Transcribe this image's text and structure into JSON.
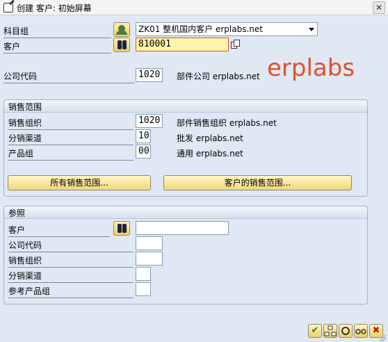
{
  "window": {
    "title": "创建 客户: 初始屏幕",
    "close_glyph": "✕"
  },
  "fields": {
    "account_group": {
      "label": "科目组",
      "value": "ZK01 整机国内客户 erplabs.net"
    },
    "customer": {
      "label": "客户",
      "value": "810001"
    },
    "company_code": {
      "label": "公司代码",
      "value": "1020",
      "desc": "部件公司 erplabs.net"
    }
  },
  "watermark": "erplabs",
  "sales_area": {
    "title": "销售范围",
    "rows": [
      {
        "label": "销售组织",
        "value": "1020",
        "desc": "部件销售组织 erplabs.net"
      },
      {
        "label": "分销渠道",
        "value": "10",
        "desc": "批发 erplabs.net"
      },
      {
        "label": "产品组",
        "value": "00",
        "desc": "通用 erplabs.net"
      }
    ],
    "btn_all": "所有销售范围...",
    "btn_customer": "客户的销售范围..."
  },
  "reference": {
    "title": "参照",
    "rows": [
      {
        "label": "客户",
        "value": ""
      },
      {
        "label": "公司代码",
        "value": ""
      },
      {
        "label": "销售组织",
        "value": ""
      },
      {
        "label": "分销渠道",
        "value": ""
      },
      {
        "label": "参考产品组",
        "value": ""
      }
    ]
  },
  "toolbar": {
    "confirm_glyph": "✔",
    "cancel_glyph": "✖"
  }
}
